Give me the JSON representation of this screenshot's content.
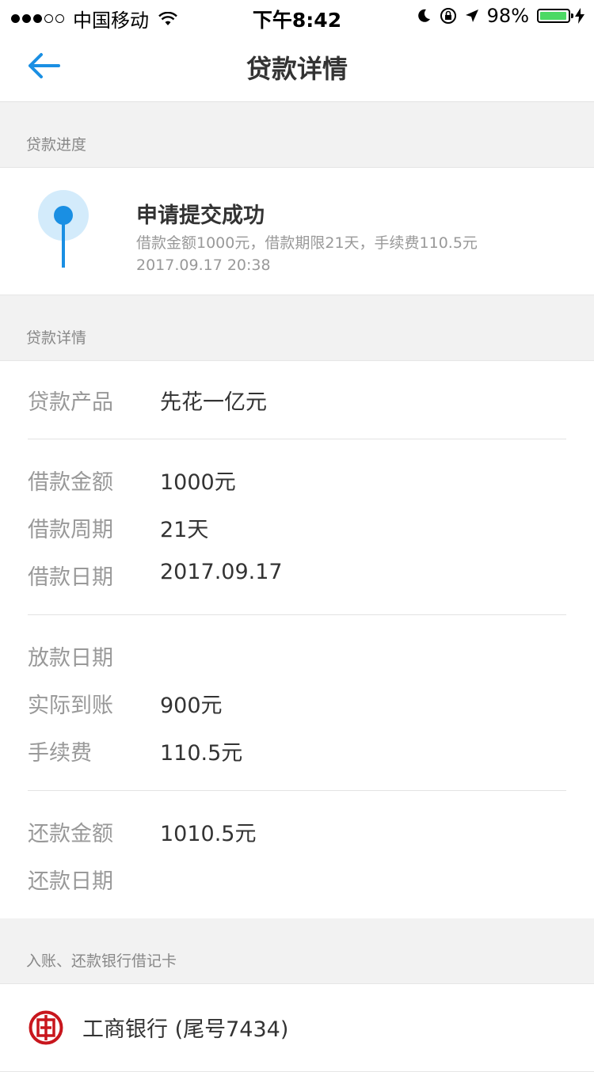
{
  "status_bar": {
    "carrier": "中国移动",
    "time": "下午8:42",
    "battery": "98%",
    "battery_level": 0.98
  },
  "nav": {
    "title": "贷款详情"
  },
  "progress_section": {
    "header": "贷款进度",
    "status_title": "申请提交成功",
    "description": "借款金额1000元，借款期限21天，手续费110.5元",
    "time": "2017.09.17 20:38"
  },
  "detail_section": {
    "header": "贷款详情",
    "product": {
      "label": "贷款产品",
      "value": "先花一亿元"
    },
    "loan_amount": {
      "label": "借款金额",
      "value": "1000元"
    },
    "loan_period": {
      "label": "借款周期",
      "value": "21天"
    },
    "loan_date": {
      "label": "借款日期",
      "value": "2017.09.17"
    },
    "disburse_date": {
      "label": "放款日期",
      "value": ""
    },
    "actual_received": {
      "label": "实际到账",
      "value": "900元"
    },
    "fee": {
      "label": "手续费",
      "value": "110.5元"
    },
    "repay_amount": {
      "label": "还款金额",
      "value": "1010.5元"
    },
    "repay_date": {
      "label": "还款日期",
      "value": ""
    }
  },
  "bank_section": {
    "header": "入账、还款银行借记卡",
    "bank_name": "工商银行 (尾号7434)"
  },
  "colors": {
    "accent": "#1a8fe3",
    "accent_light": "#d3ebfb",
    "bank_red": "#c8161d"
  }
}
